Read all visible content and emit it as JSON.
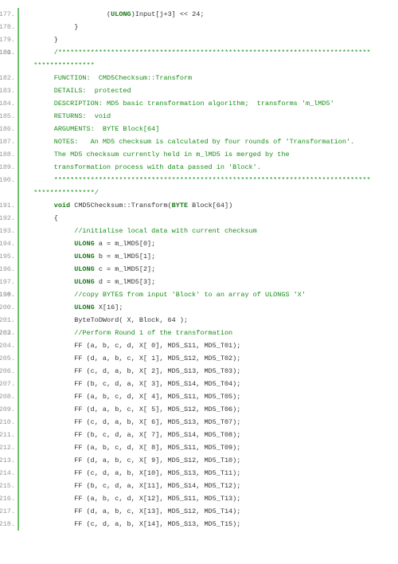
{
  "lines": [
    {
      "n": "177.",
      "indent": "                    ",
      "segs": [
        {
          "t": "(",
          "c": ""
        },
        {
          "t": "ULONG",
          "c": "type"
        },
        {
          "t": ")Input[j+3] << 24;",
          "c": ""
        }
      ]
    },
    {
      "n": "178.",
      "indent": "            ",
      "segs": [
        {
          "t": "}",
          "c": ""
        }
      ]
    },
    {
      "n": "179.",
      "indent": "       ",
      "segs": [
        {
          "t": "}",
          "c": ""
        }
      ]
    },
    {
      "n": "180.",
      "indent": "",
      "segs": []
    },
    {
      "n": "181.",
      "indent": "       ",
      "segs": [
        {
          "t": "/*****************************************************************************",
          "c": "comment"
        }
      ]
    },
    {
      "n": "",
      "indent": "  ",
      "segs": [
        {
          "t": "***************",
          "c": "comment"
        }
      ]
    },
    {
      "n": "182.",
      "indent": "       ",
      "segs": [
        {
          "t": "FUNCTION:  CMD5Checksum::Transform",
          "c": "comment"
        }
      ]
    },
    {
      "n": "183.",
      "indent": "       ",
      "segs": [
        {
          "t": "DETAILS:  protected",
          "c": "comment"
        }
      ]
    },
    {
      "n": "184.",
      "indent": "       ",
      "segs": [
        {
          "t": "DESCRIPTION: MD5 basic transformation algorithm;  transforms 'm_lMD5'",
          "c": "comment"
        }
      ]
    },
    {
      "n": "185.",
      "indent": "       ",
      "segs": [
        {
          "t": "RETURNS:  void",
          "c": "comment"
        }
      ]
    },
    {
      "n": "186.",
      "indent": "       ",
      "segs": [
        {
          "t": "ARGUMENTS:  BYTE Block[64]",
          "c": "comment"
        }
      ]
    },
    {
      "n": "187.",
      "indent": "       ",
      "segs": [
        {
          "t": "NOTES:   An MD5 checksum is calculated by four rounds of 'Transformation'.",
          "c": "comment"
        }
      ]
    },
    {
      "n": "188.",
      "indent": "       ",
      "segs": [
        {
          "t": "The MD5 checksum currently held in m_lMD5 is merged by the ",
          "c": "comment"
        }
      ]
    },
    {
      "n": "189.",
      "indent": "       ",
      "segs": [
        {
          "t": "transformation process with data passed in 'Block'.  ",
          "c": "comment"
        }
      ]
    },
    {
      "n": "190.",
      "indent": "       ",
      "segs": [
        {
          "t": "******************************************************************************",
          "c": "comment"
        }
      ]
    },
    {
      "n": "",
      "indent": "  ",
      "segs": [
        {
          "t": "***************/",
          "c": "comment"
        }
      ]
    },
    {
      "n": "191.",
      "indent": "       ",
      "segs": [
        {
          "t": "void",
          "c": "keyword"
        },
        {
          "t": " CMD5Checksum::Transform(",
          "c": ""
        },
        {
          "t": "BYTE",
          "c": "type"
        },
        {
          "t": " Block[64])",
          "c": ""
        }
      ]
    },
    {
      "n": "192.",
      "indent": "       ",
      "segs": [
        {
          "t": "{",
          "c": ""
        }
      ]
    },
    {
      "n": "193.",
      "indent": "            ",
      "segs": [
        {
          "t": "//initialise local data with current checksum",
          "c": "comment"
        }
      ]
    },
    {
      "n": "194.",
      "indent": "            ",
      "segs": [
        {
          "t": "ULONG",
          "c": "type"
        },
        {
          "t": " a = m_lMD5[0];",
          "c": ""
        }
      ]
    },
    {
      "n": "195.",
      "indent": "            ",
      "segs": [
        {
          "t": "ULONG",
          "c": "type"
        },
        {
          "t": " b = m_lMD5[1];",
          "c": ""
        }
      ]
    },
    {
      "n": "196.",
      "indent": "            ",
      "segs": [
        {
          "t": "ULONG",
          "c": "type"
        },
        {
          "t": " c = m_lMD5[2];",
          "c": ""
        }
      ]
    },
    {
      "n": "197.",
      "indent": "            ",
      "segs": [
        {
          "t": "ULONG",
          "c": "type"
        },
        {
          "t": " d = m_lMD5[3];",
          "c": ""
        }
      ]
    },
    {
      "n": "198.",
      "indent": "",
      "segs": []
    },
    {
      "n": "199.",
      "indent": "            ",
      "segs": [
        {
          "t": "//copy BYTES from input 'Block' to an array of ULONGS 'X'",
          "c": "comment"
        }
      ]
    },
    {
      "n": "200.",
      "indent": "            ",
      "segs": [
        {
          "t": "ULONG",
          "c": "type"
        },
        {
          "t": " X[16];",
          "c": ""
        }
      ]
    },
    {
      "n": "201.",
      "indent": "            ",
      "segs": [
        {
          "t": "ByteToDWord( X, Block, 64 );",
          "c": ""
        }
      ]
    },
    {
      "n": "202.",
      "indent": "",
      "segs": []
    },
    {
      "n": "203.",
      "indent": "            ",
      "segs": [
        {
          "t": "//Perform Round 1 of the transformation",
          "c": "comment"
        }
      ]
    },
    {
      "n": "204.",
      "indent": "            ",
      "segs": [
        {
          "t": "FF (a, b, c, d, X[ 0], MD5_S11, MD5_T01);",
          "c": ""
        }
      ]
    },
    {
      "n": "205.",
      "indent": "            ",
      "segs": [
        {
          "t": "FF (d, a, b, c, X[ 1], MD5_S12, MD5_T02);",
          "c": ""
        }
      ]
    },
    {
      "n": "206.",
      "indent": "            ",
      "segs": [
        {
          "t": "FF (c, d, a, b, X[ 2], MD5_S13, MD5_T03);",
          "c": ""
        }
      ]
    },
    {
      "n": "207.",
      "indent": "            ",
      "segs": [
        {
          "t": "FF (b, c, d, a, X[ 3], MD5_S14, MD5_T04);",
          "c": ""
        }
      ]
    },
    {
      "n": "208.",
      "indent": "            ",
      "segs": [
        {
          "t": "FF (a, b, c, d, X[ 4], MD5_S11, MD5_T05);",
          "c": ""
        }
      ]
    },
    {
      "n": "209.",
      "indent": "            ",
      "segs": [
        {
          "t": "FF (d, a, b, c, X[ 5], MD5_S12, MD5_T06);",
          "c": ""
        }
      ]
    },
    {
      "n": "210.",
      "indent": "            ",
      "segs": [
        {
          "t": "FF (c, d, a, b, X[ 6], MD5_S13, MD5_T07);",
          "c": ""
        }
      ]
    },
    {
      "n": "211.",
      "indent": "            ",
      "segs": [
        {
          "t": "FF (b, c, d, a, X[ 7], MD5_S14, MD5_T08);",
          "c": ""
        }
      ]
    },
    {
      "n": "212.",
      "indent": "            ",
      "segs": [
        {
          "t": "FF (a, b, c, d, X[ 8], MD5_S11, MD5_T09);",
          "c": ""
        }
      ]
    },
    {
      "n": "213.",
      "indent": "            ",
      "segs": [
        {
          "t": "FF (d, a, b, c, X[ 9], MD5_S12, MD5_T10);",
          "c": ""
        }
      ]
    },
    {
      "n": "214.",
      "indent": "            ",
      "segs": [
        {
          "t": "FF (c, d, a, b, X[10], MD5_S13, MD5_T11);",
          "c": ""
        }
      ]
    },
    {
      "n": "215.",
      "indent": "            ",
      "segs": [
        {
          "t": "FF (b, c, d, a, X[11], MD5_S14, MD5_T12);",
          "c": ""
        }
      ]
    },
    {
      "n": "216.",
      "indent": "            ",
      "segs": [
        {
          "t": "FF (a, b, c, d, X[12], MD5_S11, MD5_T13);",
          "c": ""
        }
      ]
    },
    {
      "n": "217.",
      "indent": "            ",
      "segs": [
        {
          "t": "FF (d, a, b, c, X[13], MD5_S12, MD5_T14);",
          "c": ""
        }
      ]
    },
    {
      "n": "218.",
      "indent": "            ",
      "segs": [
        {
          "t": "FF (c, d, a, b, X[14], MD5_S13, MD5_T15);",
          "c": ""
        }
      ]
    }
  ]
}
